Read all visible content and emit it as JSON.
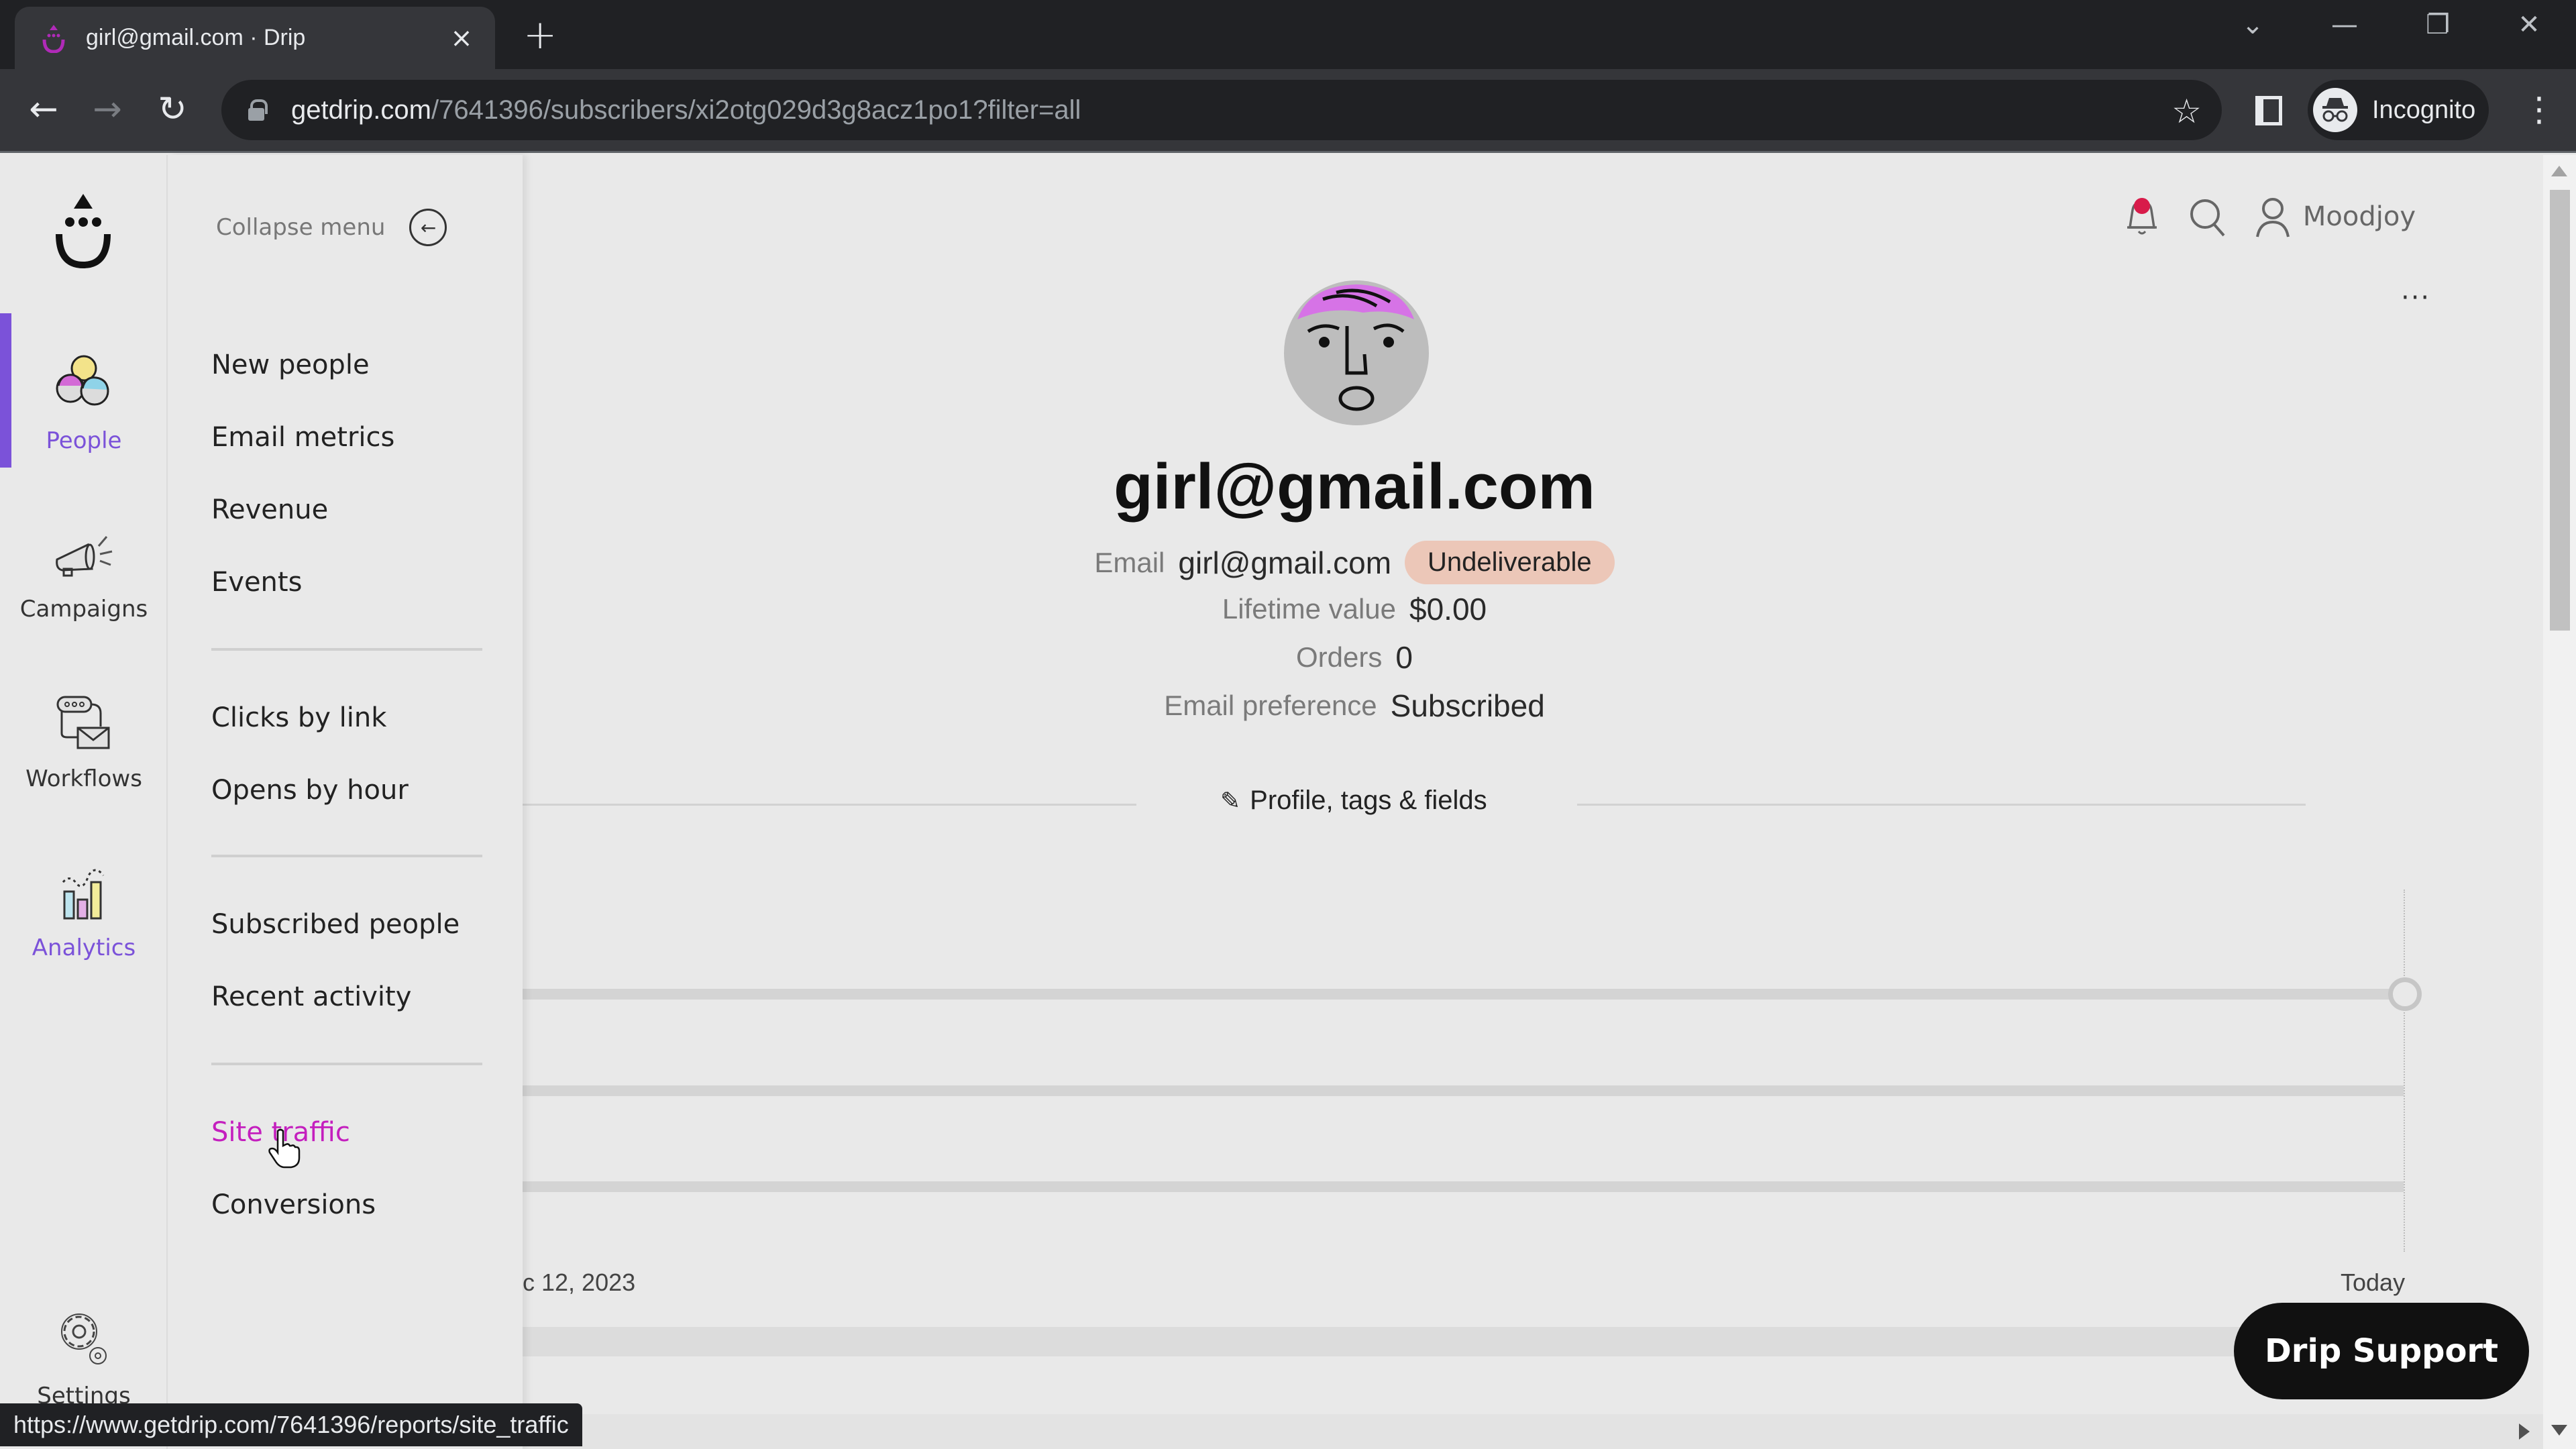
{
  "browser": {
    "tab": {
      "title": "girl@gmail.com · Drip",
      "close_label": "×"
    },
    "new_tab_label": "+",
    "url": {
      "host": "getdrip.com",
      "path": "/7641396/subscribers/xi2otg029d3g8acz1po1?filter=all"
    },
    "profile_label": "Incognito",
    "window_controls": {
      "tab_search": "⌄",
      "minimize": "—",
      "restore": "❐",
      "close": "✕"
    },
    "status_url": "https://www.getdrip.com/7641396/reports/site_traffic"
  },
  "rail": {
    "items": [
      {
        "label": "People",
        "icon": "people-icon",
        "active": true
      },
      {
        "label": "Campaigns",
        "icon": "megaphone-icon"
      },
      {
        "label": "Workflows",
        "icon": "workflow-icon"
      },
      {
        "label": "Analytics",
        "icon": "analytics-icon",
        "highlighted": true
      },
      {
        "label": "Settings",
        "icon": "gear-icon"
      }
    ]
  },
  "submenu": {
    "collapse_label": "Collapse menu",
    "groups": [
      [
        "New people",
        "Email metrics",
        "Revenue",
        "Events"
      ],
      [
        "Clicks by link",
        "Opens by hour"
      ],
      [
        "Subscribed people",
        "Recent activity"
      ],
      [
        "Site traffic",
        "Conversions"
      ]
    ],
    "hovered_item": "Site traffic"
  },
  "header": {
    "account_name": "Moodjoy",
    "more_label": "···"
  },
  "profile": {
    "title": "girl@gmail.com",
    "email_label": "Email",
    "email_value": "girl@gmail.com",
    "email_status": "Undeliverable",
    "lifetime_value_label": "Lifetime value",
    "lifetime_value": "$0.00",
    "orders_label": "Orders",
    "orders": "0",
    "email_preference_label": "Email preference",
    "email_preference": "Subscribed",
    "profile_link_label": "Profile, tags & fields"
  },
  "timeline": {
    "start_label": "c 12, 2023",
    "end_label": "Today"
  },
  "support_button_label": "Drip Support",
  "colors": {
    "accent_purple": "#7b52d9",
    "hover_magenta": "#c41fbe",
    "badge_undeliverable": "#ecc7b8",
    "notification_dot": "#d81b4a"
  }
}
